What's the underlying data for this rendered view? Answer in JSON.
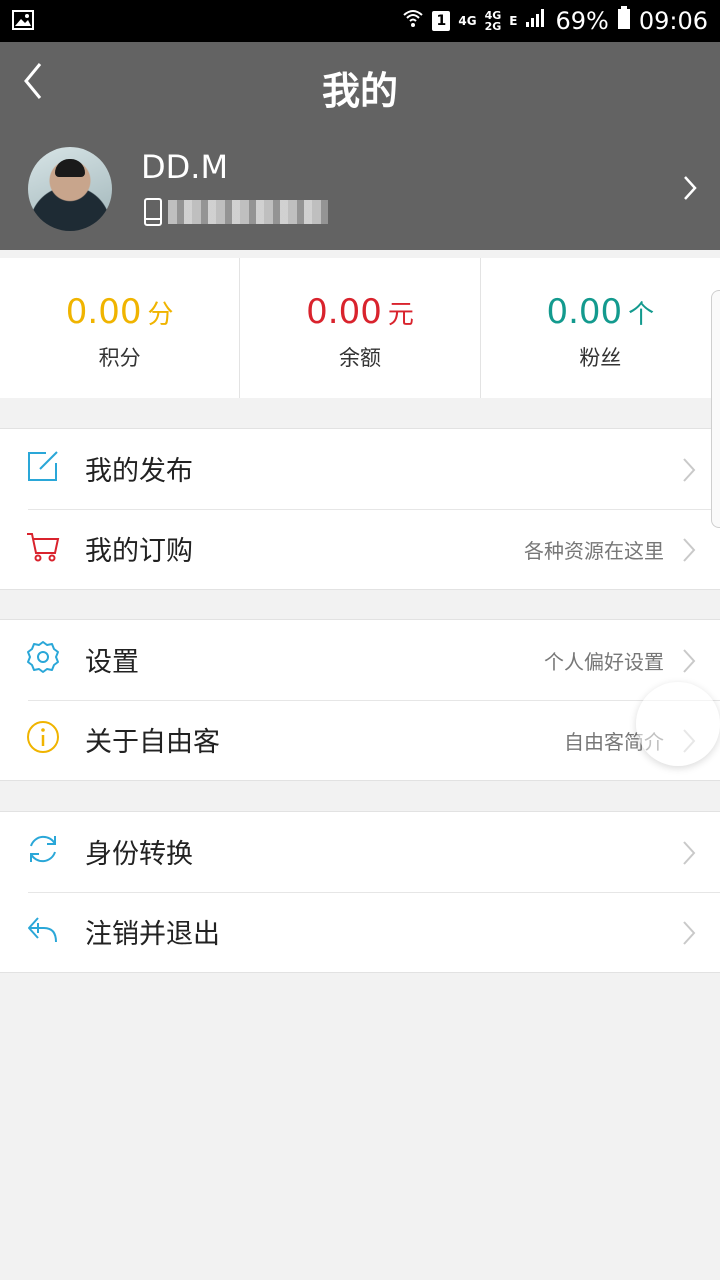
{
  "status_bar": {
    "battery": "69%",
    "time": "09:06",
    "sim_slot": "1",
    "net_4g": "4G",
    "net_4g2g_top": "4G",
    "net_4g2g_bottom": "2G",
    "net_e": "E"
  },
  "header": {
    "title": "我的",
    "username": "DD.M"
  },
  "stats": [
    {
      "value": "0.00",
      "unit": "分",
      "label": "积分",
      "color": "#f0b400"
    },
    {
      "value": "0.00",
      "unit": "元",
      "label": "余额",
      "color": "#d9232d"
    },
    {
      "value": "0.00",
      "unit": "个",
      "label": "粉丝",
      "color": "#139a8e"
    }
  ],
  "menu": {
    "group1": [
      {
        "label": "我的发布",
        "hint": "",
        "icon": "edit-icon"
      },
      {
        "label": "我的订购",
        "hint": "各种资源在这里",
        "icon": "cart-icon"
      }
    ],
    "group2": [
      {
        "label": "设置",
        "hint": "个人偏好设置",
        "icon": "gear-icon"
      },
      {
        "label": "关于自由客",
        "hint": "自由客简介",
        "icon": "info-icon"
      }
    ],
    "group3": [
      {
        "label": "身份转换",
        "hint": "",
        "icon": "switch-icon"
      },
      {
        "label": "注销并退出",
        "hint": "",
        "icon": "logout-icon"
      }
    ]
  },
  "colors": {
    "header_bg": "#636363",
    "icon_blue": "#2aa7d8",
    "icon_red": "#d9232d",
    "icon_yellow": "#f0b400"
  }
}
